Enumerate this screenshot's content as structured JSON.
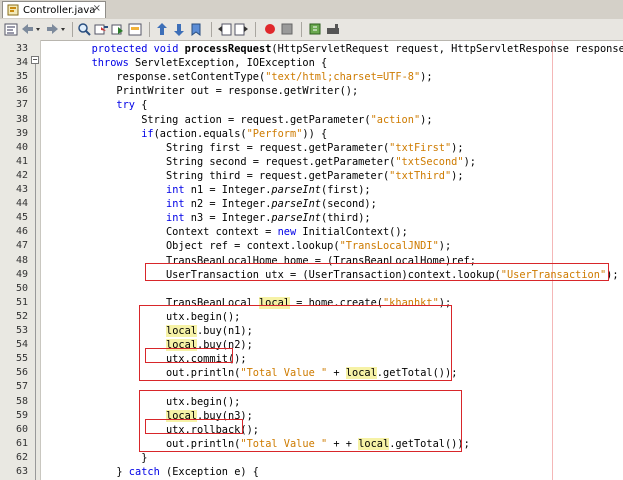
{
  "tab": {
    "title": "Controller.java",
    "close": "×"
  },
  "toolbar": {
    "icons": [
      "source-icon",
      "history-icon",
      "back-icon",
      "forward-icon",
      "find-icon",
      "find-prev-icon",
      "find-next-icon",
      "find-selection-icon",
      "prev-bookmark-icon",
      "next-bookmark-icon",
      "toggle-bookmark-icon",
      "shift-left-icon",
      "shift-right-icon",
      "macro-record-icon",
      "macro-stop-icon",
      "comment-icon",
      "uncomment-icon"
    ]
  },
  "colors": {
    "keyword": "#0000e6",
    "string": "#ce7b00",
    "highlight": "#f6f2a6",
    "box": "#d8262a"
  },
  "lines": [
    {
      "num": "33",
      "parts": [
        [
          "        ",
          ""
        ],
        [
          "protected void ",
          "kw"
        ],
        [
          "processRequest",
          "bold"
        ],
        [
          "(HttpServletRequest request, HttpServletResponse response)",
          ""
        ]
      ]
    },
    {
      "num": "34",
      "parts": [
        [
          "        ",
          ""
        ],
        [
          "throws ",
          "kw"
        ],
        [
          "ServletException, IOException {",
          ""
        ]
      ]
    },
    {
      "num": "35",
      "parts": [
        [
          "            response.setContentType(",
          ""
        ],
        [
          "\"text/html;charset=UTF-8\"",
          "str"
        ],
        [
          ");",
          ""
        ]
      ]
    },
    {
      "num": "36",
      "parts": [
        [
          "            PrintWriter out = response.getWriter();",
          ""
        ]
      ]
    },
    {
      "num": "37",
      "parts": [
        [
          "            ",
          ""
        ],
        [
          "try",
          "kw"
        ],
        [
          " {",
          ""
        ]
      ]
    },
    {
      "num": "38",
      "parts": [
        [
          "                String action = request.getParameter(",
          ""
        ],
        [
          "\"action\"",
          "str"
        ],
        [
          ");",
          ""
        ]
      ]
    },
    {
      "num": "39",
      "parts": [
        [
          "                ",
          ""
        ],
        [
          "if",
          "kw"
        ],
        [
          "(action.equals(",
          ""
        ],
        [
          "\"Perform\"",
          "str"
        ],
        [
          ")) {",
          ""
        ]
      ]
    },
    {
      "num": "40",
      "parts": [
        [
          "                    String first = request.getParameter(",
          ""
        ],
        [
          "\"txtFirst\"",
          "str"
        ],
        [
          ");",
          ""
        ]
      ]
    },
    {
      "num": "41",
      "parts": [
        [
          "                    String second = request.getParameter(",
          ""
        ],
        [
          "\"txtSecond\"",
          "str"
        ],
        [
          ");",
          ""
        ]
      ]
    },
    {
      "num": "42",
      "parts": [
        [
          "                    String third = request.getParameter(",
          ""
        ],
        [
          "\"txtThird\"",
          "str"
        ],
        [
          ");",
          ""
        ]
      ]
    },
    {
      "num": "43",
      "parts": [
        [
          "                    ",
          ""
        ],
        [
          "int",
          "kw"
        ],
        [
          " n1 = Integer.",
          ""
        ],
        [
          "parseInt",
          "italic"
        ],
        [
          "(first);",
          ""
        ]
      ]
    },
    {
      "num": "44",
      "parts": [
        [
          "                    ",
          ""
        ],
        [
          "int",
          "kw"
        ],
        [
          " n2 = Integer.",
          ""
        ],
        [
          "parseInt",
          "italic"
        ],
        [
          "(second);",
          ""
        ]
      ]
    },
    {
      "num": "45",
      "parts": [
        [
          "                    ",
          ""
        ],
        [
          "int",
          "kw"
        ],
        [
          " n3 = Integer.",
          ""
        ],
        [
          "parseInt",
          "italic"
        ],
        [
          "(third);",
          ""
        ]
      ]
    },
    {
      "num": "46",
      "parts": [
        [
          "                    Context context = ",
          ""
        ],
        [
          "new",
          "kw"
        ],
        [
          " InitialContext();",
          ""
        ]
      ]
    },
    {
      "num": "47",
      "parts": [
        [
          "                    Object ref = context.lookup(",
          ""
        ],
        [
          "\"TransLocalJNDI\"",
          "str"
        ],
        [
          ");",
          ""
        ]
      ]
    },
    {
      "num": "48",
      "parts": [
        [
          "                    TransBeanLocalHome home = (TransBeanLocalHome)ref;",
          ""
        ]
      ]
    },
    {
      "num": "49",
      "parts": [
        [
          "                    UserTransaction utx = (UserTransaction)context.lookup(",
          ""
        ],
        [
          "\"UserTransaction\"",
          "str"
        ],
        [
          ");",
          ""
        ]
      ]
    },
    {
      "num": "50",
      "parts": [
        [
          "",
          ""
        ]
      ]
    },
    {
      "num": "51",
      "parts": [
        [
          "                    TransBeanLocal ",
          ""
        ],
        [
          "local",
          "hl"
        ],
        [
          " = home.create(",
          ""
        ],
        [
          "\"khanhkt\"",
          "str"
        ],
        [
          ");",
          ""
        ]
      ]
    },
    {
      "num": "52",
      "parts": [
        [
          "                    utx.begin();",
          ""
        ]
      ]
    },
    {
      "num": "53",
      "parts": [
        [
          "                    ",
          ""
        ],
        [
          "local",
          "hl"
        ],
        [
          ".buy(n1);",
          ""
        ]
      ]
    },
    {
      "num": "54",
      "parts": [
        [
          "                    ",
          ""
        ],
        [
          "local",
          "hl"
        ],
        [
          ".buy(n2);",
          ""
        ]
      ]
    },
    {
      "num": "55",
      "parts": [
        [
          "                    utx.commit();",
          ""
        ]
      ]
    },
    {
      "num": "56",
      "parts": [
        [
          "                    out.println(",
          ""
        ],
        [
          "\"Total Value \"",
          "str"
        ],
        [
          " + ",
          ""
        ],
        [
          "local",
          "hl"
        ],
        [
          ".getTotal());",
          ""
        ]
      ]
    },
    {
      "num": "57",
      "parts": [
        [
          "",
          ""
        ]
      ]
    },
    {
      "num": "58",
      "parts": [
        [
          "                    utx.begin();",
          ""
        ]
      ]
    },
    {
      "num": "59",
      "parts": [
        [
          "                    ",
          ""
        ],
        [
          "local",
          "hl"
        ],
        [
          ".buy(n3);",
          ""
        ]
      ]
    },
    {
      "num": "60",
      "parts": [
        [
          "                    utx.rollback();",
          ""
        ]
      ]
    },
    {
      "num": "61",
      "parts": [
        [
          "                    out.println(",
          ""
        ],
        [
          "\"Total Value \"",
          "str"
        ],
        [
          " + + ",
          ""
        ],
        [
          "local",
          "hl"
        ],
        [
          ".getTotal());",
          ""
        ]
      ]
    },
    {
      "num": "62",
      "parts": [
        [
          "                }",
          ""
        ]
      ]
    },
    {
      "num": "63",
      "parts": [
        [
          "            } ",
          ""
        ],
        [
          "catch",
          "kw"
        ],
        [
          " (Exception e) {",
          ""
        ]
      ]
    }
  ]
}
